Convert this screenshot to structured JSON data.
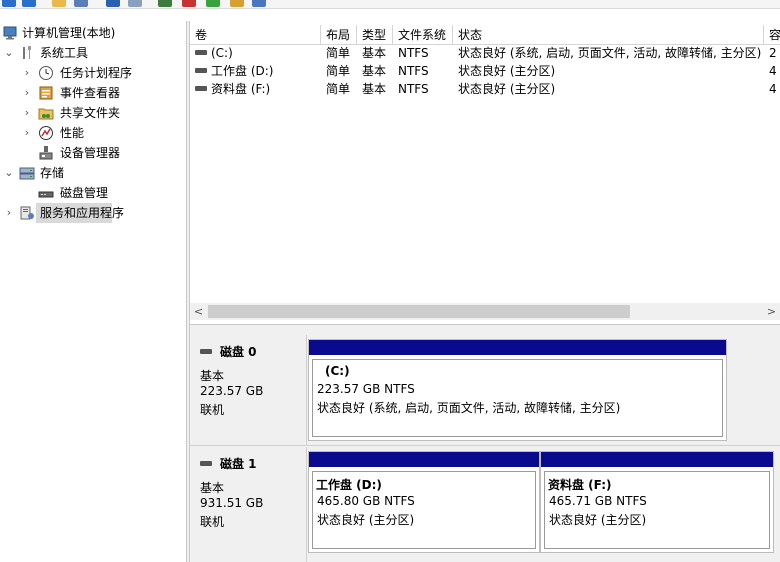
{
  "tree": {
    "root": "计算机管理(本地)",
    "system_tools": "系统工具",
    "task_scheduler": "任务计划程序",
    "event_viewer": "事件查看器",
    "shared_folders": "共享文件夹",
    "performance": "性能",
    "device_manager": "设备管理器",
    "storage": "存储",
    "disk_management": "磁盘管理",
    "services_apps": "服务和应用程序"
  },
  "volume_list": {
    "columns": [
      "卷",
      "布局",
      "类型",
      "文件系统",
      "状态",
      "容"
    ],
    "rows": [
      {
        "volume": "(C:)",
        "layout": "简单",
        "type": "基本",
        "fs": "NTFS",
        "status": "状态良好 (系统, 启动, 页面文件, 活动, 故障转储, 主分区)",
        "cap": "2"
      },
      {
        "volume": "工作盘 (D:)",
        "layout": "简单",
        "type": "基本",
        "fs": "NTFS",
        "status": "状态良好 (主分区)",
        "cap": "4"
      },
      {
        "volume": "资料盘 (F:)",
        "layout": "简单",
        "type": "基本",
        "fs": "NTFS",
        "status": "状态良好 (主分区)",
        "cap": "4"
      }
    ],
    "scroll_left": "<",
    "scroll_right": ">"
  },
  "disks": [
    {
      "name": "磁盘 0",
      "type": "基本",
      "size": "223.57 GB",
      "state": "联机",
      "partitions": [
        {
          "name": "(C:)",
          "size_fs": "223.57 GB NTFS",
          "status": "状态良好 (系统, 启动, 页面文件, 活动, 故障转储, 主分区)"
        }
      ]
    },
    {
      "name": "磁盘 1",
      "type": "基本",
      "size": "931.51 GB",
      "state": "联机",
      "partitions": [
        {
          "name": "工作盘  (D:)",
          "size_fs": "465.80 GB NTFS",
          "status": "状态良好 (主分区)"
        },
        {
          "name": "资料盘  (F:)",
          "size_fs": "465.71 GB NTFS",
          "status": "状态良好 (主分区)"
        }
      ]
    }
  ],
  "colors": {
    "partition_bar": "#0a0a8c",
    "selection": "#d9d9d9"
  }
}
